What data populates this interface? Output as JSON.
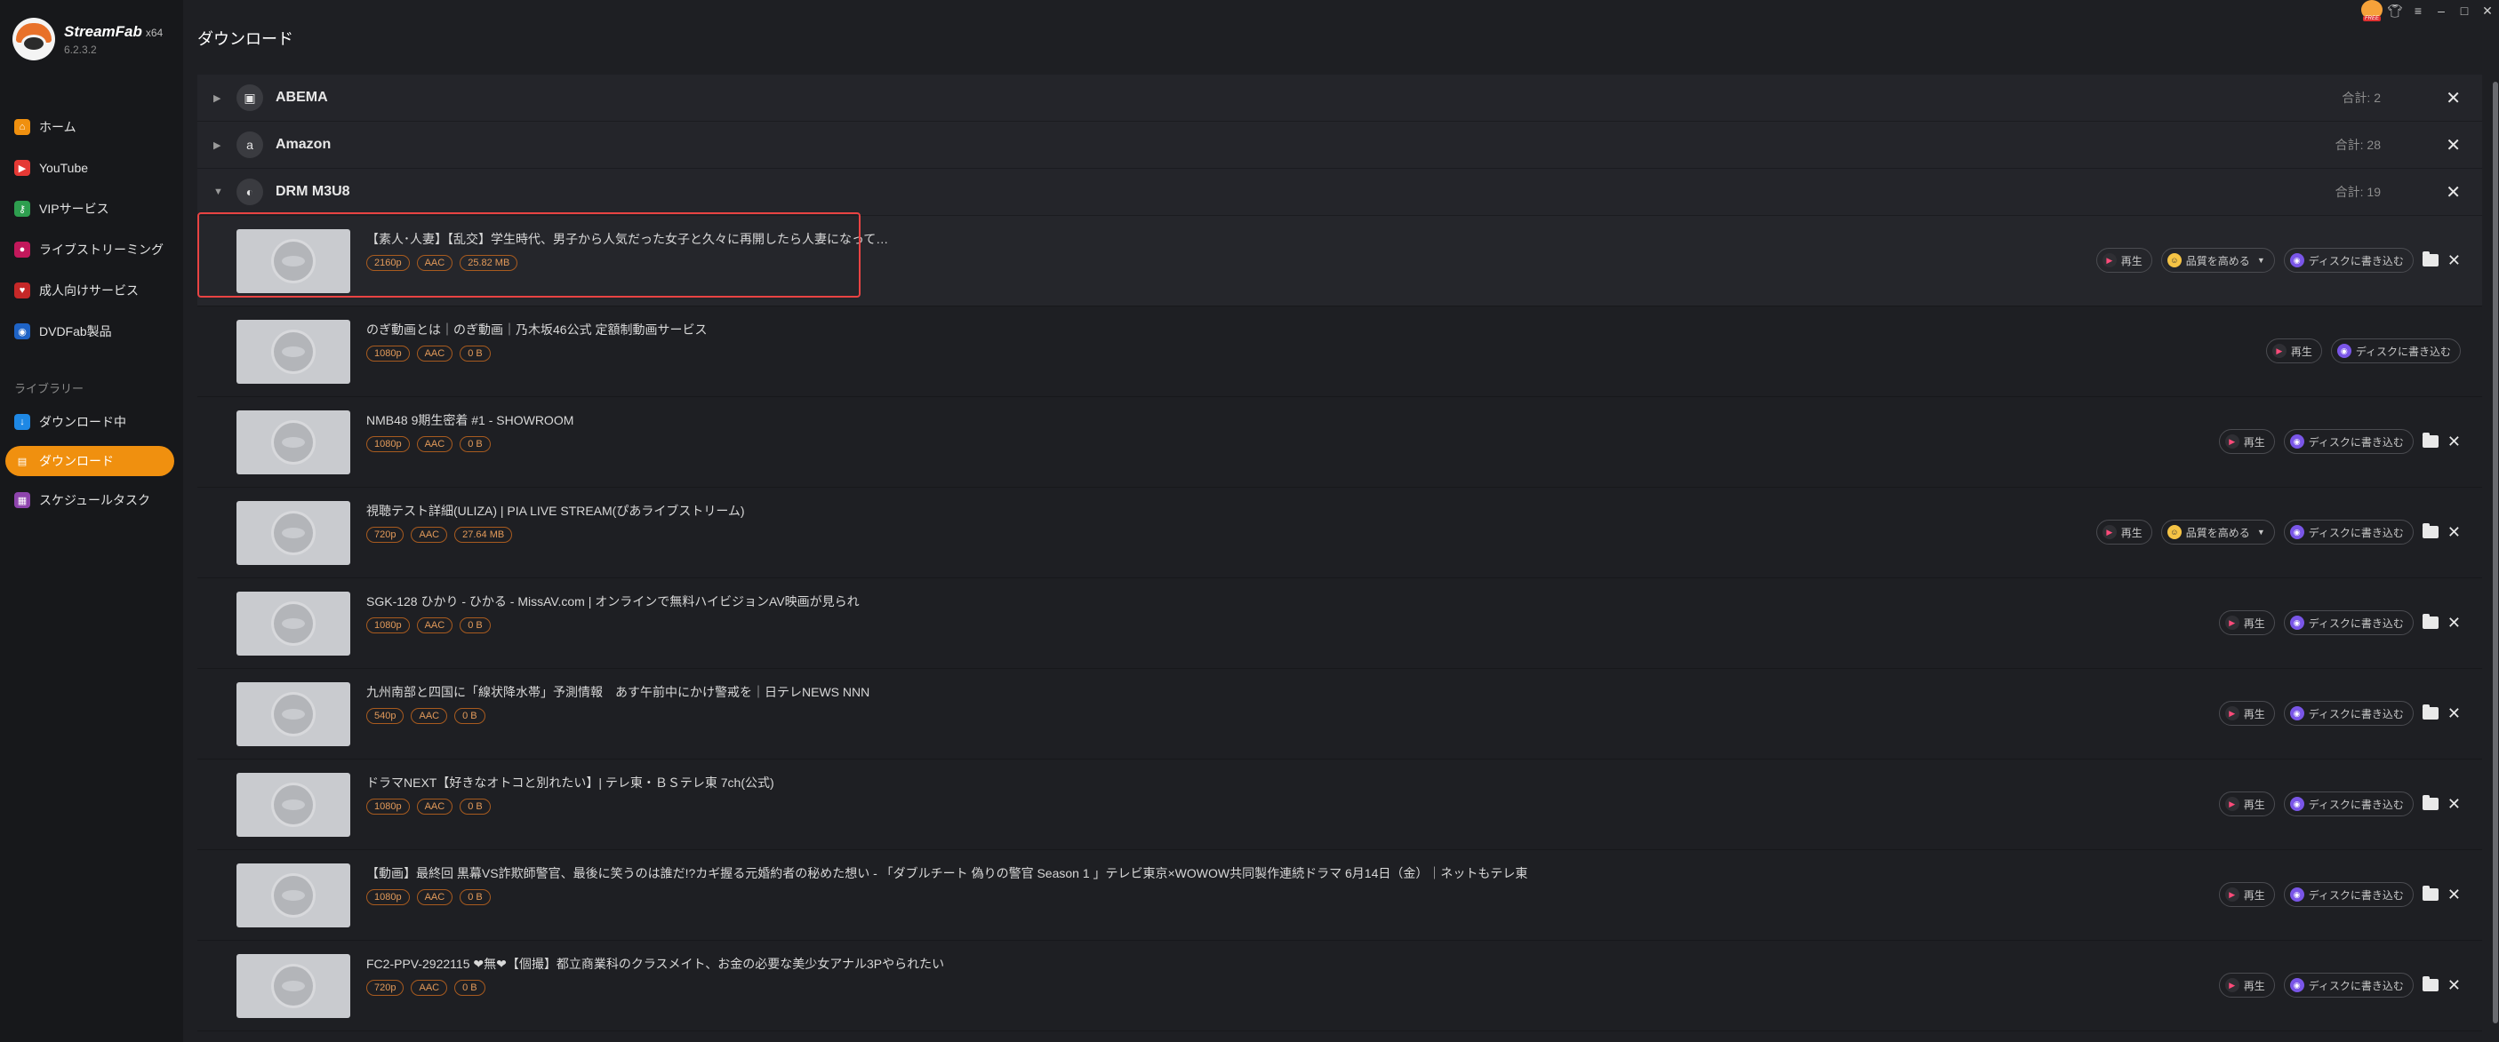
{
  "app": {
    "name": "StreamFab",
    "arch": "x64",
    "version": "6.2.3.2"
  },
  "sidebar": {
    "items": [
      {
        "label": "ホーム",
        "icon": "home-icon",
        "color": "#f0900f"
      },
      {
        "label": "YouTube",
        "icon": "youtube-icon",
        "color": "#e53935"
      },
      {
        "label": "VIPサービス",
        "icon": "key-icon",
        "color": "#2e9e4f"
      },
      {
        "label": "ライブストリーミング",
        "icon": "live-icon",
        "color": "#c2185b"
      },
      {
        "label": "成人向けサービス",
        "icon": "adult-icon",
        "color": "#c62828"
      },
      {
        "label": "DVDFab製品",
        "icon": "dvdfab-icon",
        "color": "#1e63c6"
      }
    ],
    "library_label": "ライブラリー",
    "library_items": [
      {
        "label": "ダウンロード中",
        "icon": "download-icon",
        "color": "#1e88e5"
      },
      {
        "label": "ダウンロード",
        "icon": "downloaded-icon",
        "color": "#f0900f",
        "active": true
      },
      {
        "label": "スケジュールタスク",
        "icon": "calendar-icon",
        "color": "#8e44ad"
      }
    ]
  },
  "page": {
    "title": "ダウンロード"
  },
  "groups": [
    {
      "name": "ABEMA",
      "icon": "abema-icon",
      "total": "合計: 2"
    },
    {
      "name": "Amazon",
      "icon": "amazon-icon",
      "total": "合計: 28"
    },
    {
      "name": "DRM M3U8",
      "icon": "drm-icon",
      "total": "合計: 19",
      "expanded": true
    }
  ],
  "buttons": {
    "play": "再生",
    "quality": "品質を高める",
    "burn": "ディスクに書き込む"
  },
  "items": [
    {
      "title": "【素人･人妻】【乱交】学生時代、男子から人気だった女子と久々に再開したら人妻になって…",
      "res": "2160p",
      "audio": "AAC",
      "size": "25.82 MB",
      "quality": true,
      "folder": true,
      "close": true
    },
    {
      "title": "のぎ動画とは｜のぎ動画｜乃木坂46公式 定額制動画サービス",
      "res": "1080p",
      "audio": "AAC",
      "size": "0 B",
      "quality": false,
      "folder": false,
      "close": false
    },
    {
      "title": "NMB48 9期生密着 #1 - SHOWROOM",
      "res": "1080p",
      "audio": "AAC",
      "size": "0 B",
      "quality": false,
      "folder": true,
      "close": true
    },
    {
      "title": "視聴テスト詳細(ULIZA) | PIA LIVE STREAM(ぴあライブストリーム)",
      "res": "720p",
      "audio": "AAC",
      "size": "27.64 MB",
      "quality": true,
      "folder": true,
      "close": true
    },
    {
      "title": "SGK-128 ひかり - ひかる - MissAV.com | オンラインで無料ハイビジョンAV映画が見られ",
      "res": "1080p",
      "audio": "AAC",
      "size": "0 B",
      "quality": false,
      "folder": true,
      "close": true
    },
    {
      "title": "九州南部と四国に「線状降水帯」予測情報　あす午前中にかけ警戒を｜日テレNEWS NNN",
      "res": "540p",
      "audio": "AAC",
      "size": "0 B",
      "quality": false,
      "folder": true,
      "close": true
    },
    {
      "title": "ドラマNEXT【好きなオトコと別れたい】| テレ東・ＢＳテレ東 7ch(公式)",
      "res": "1080p",
      "audio": "AAC",
      "size": "0 B",
      "quality": false,
      "folder": true,
      "close": true
    },
    {
      "title": "【動画】最終回 黒幕VS詐欺師警官、最後に笑うのは誰だ!?カギ握る元婚約者の秘めた想い - 「ダブルチート 偽りの警官 Season 1 」テレビ東京×WOWOW共同製作連続ドラマ 6月14日（金）｜ネットもテレ東",
      "res": "1080p",
      "audio": "AAC",
      "size": "0 B",
      "quality": false,
      "folder": true,
      "close": true
    },
    {
      "title": "FC2-PPV-2922115 ❤無❤【個撮】都立商業科のクラスメイト、お金の必要な美少女アナル3Pやられたい",
      "res": "720p",
      "audio": "AAC",
      "size": "0 B",
      "quality": false,
      "folder": true,
      "close": true
    }
  ]
}
